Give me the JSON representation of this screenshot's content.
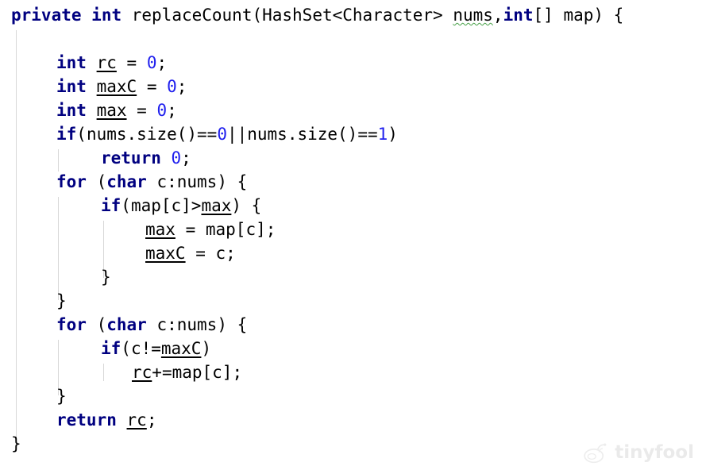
{
  "editor": {
    "language": "Java",
    "background_color": "#ffffff",
    "font_size_px": 21,
    "line_height_px": 30,
    "colors": {
      "keyword": "#000080",
      "number_literal": "#2020ee",
      "plain_text": "#000000",
      "indent_guide": "#d8d8d8",
      "warning_squiggle": "#46a046",
      "watermark": "#eaeaea"
    }
  },
  "code": {
    "lines": [
      {
        "indent": 0,
        "text": "private int replaceCount(HashSet<Character> nums,int[] map) {"
      },
      {
        "indent": 0,
        "text": ""
      },
      {
        "indent": 1,
        "text": "int rc = 0;"
      },
      {
        "indent": 1,
        "text": "int maxC = 0;"
      },
      {
        "indent": 1,
        "text": "int max = 0;"
      },
      {
        "indent": 1,
        "text": "if(nums.size()==0||nums.size()==1)"
      },
      {
        "indent": 2,
        "text": "return 0;"
      },
      {
        "indent": 1,
        "text": "for (char c:nums) {"
      },
      {
        "indent": 2,
        "text": "if(map[c]>max) {"
      },
      {
        "indent": 3,
        "text": "max = map[c];"
      },
      {
        "indent": 3,
        "text": "maxC = c;"
      },
      {
        "indent": 2,
        "text": "}"
      },
      {
        "indent": 1,
        "text": "}"
      },
      {
        "indent": 1,
        "text": "for (char c:nums) {"
      },
      {
        "indent": 2,
        "text": "if(c!=maxC)"
      },
      {
        "indent": 3,
        "text": "rc+=map[c];"
      },
      {
        "indent": 1,
        "text": "}"
      },
      {
        "indent": 1,
        "text": "return rc;"
      },
      {
        "indent": 0,
        "text": "}"
      }
    ],
    "keywords": [
      "private",
      "int",
      "if",
      "for",
      "char",
      "return"
    ],
    "local_variables": [
      "rc",
      "maxC",
      "max"
    ],
    "warned_identifiers": [
      "nums"
    ],
    "number_literals": [
      "0",
      "1"
    ]
  },
  "watermark": {
    "text": "tinyfool",
    "logo": "weibo-icon"
  }
}
